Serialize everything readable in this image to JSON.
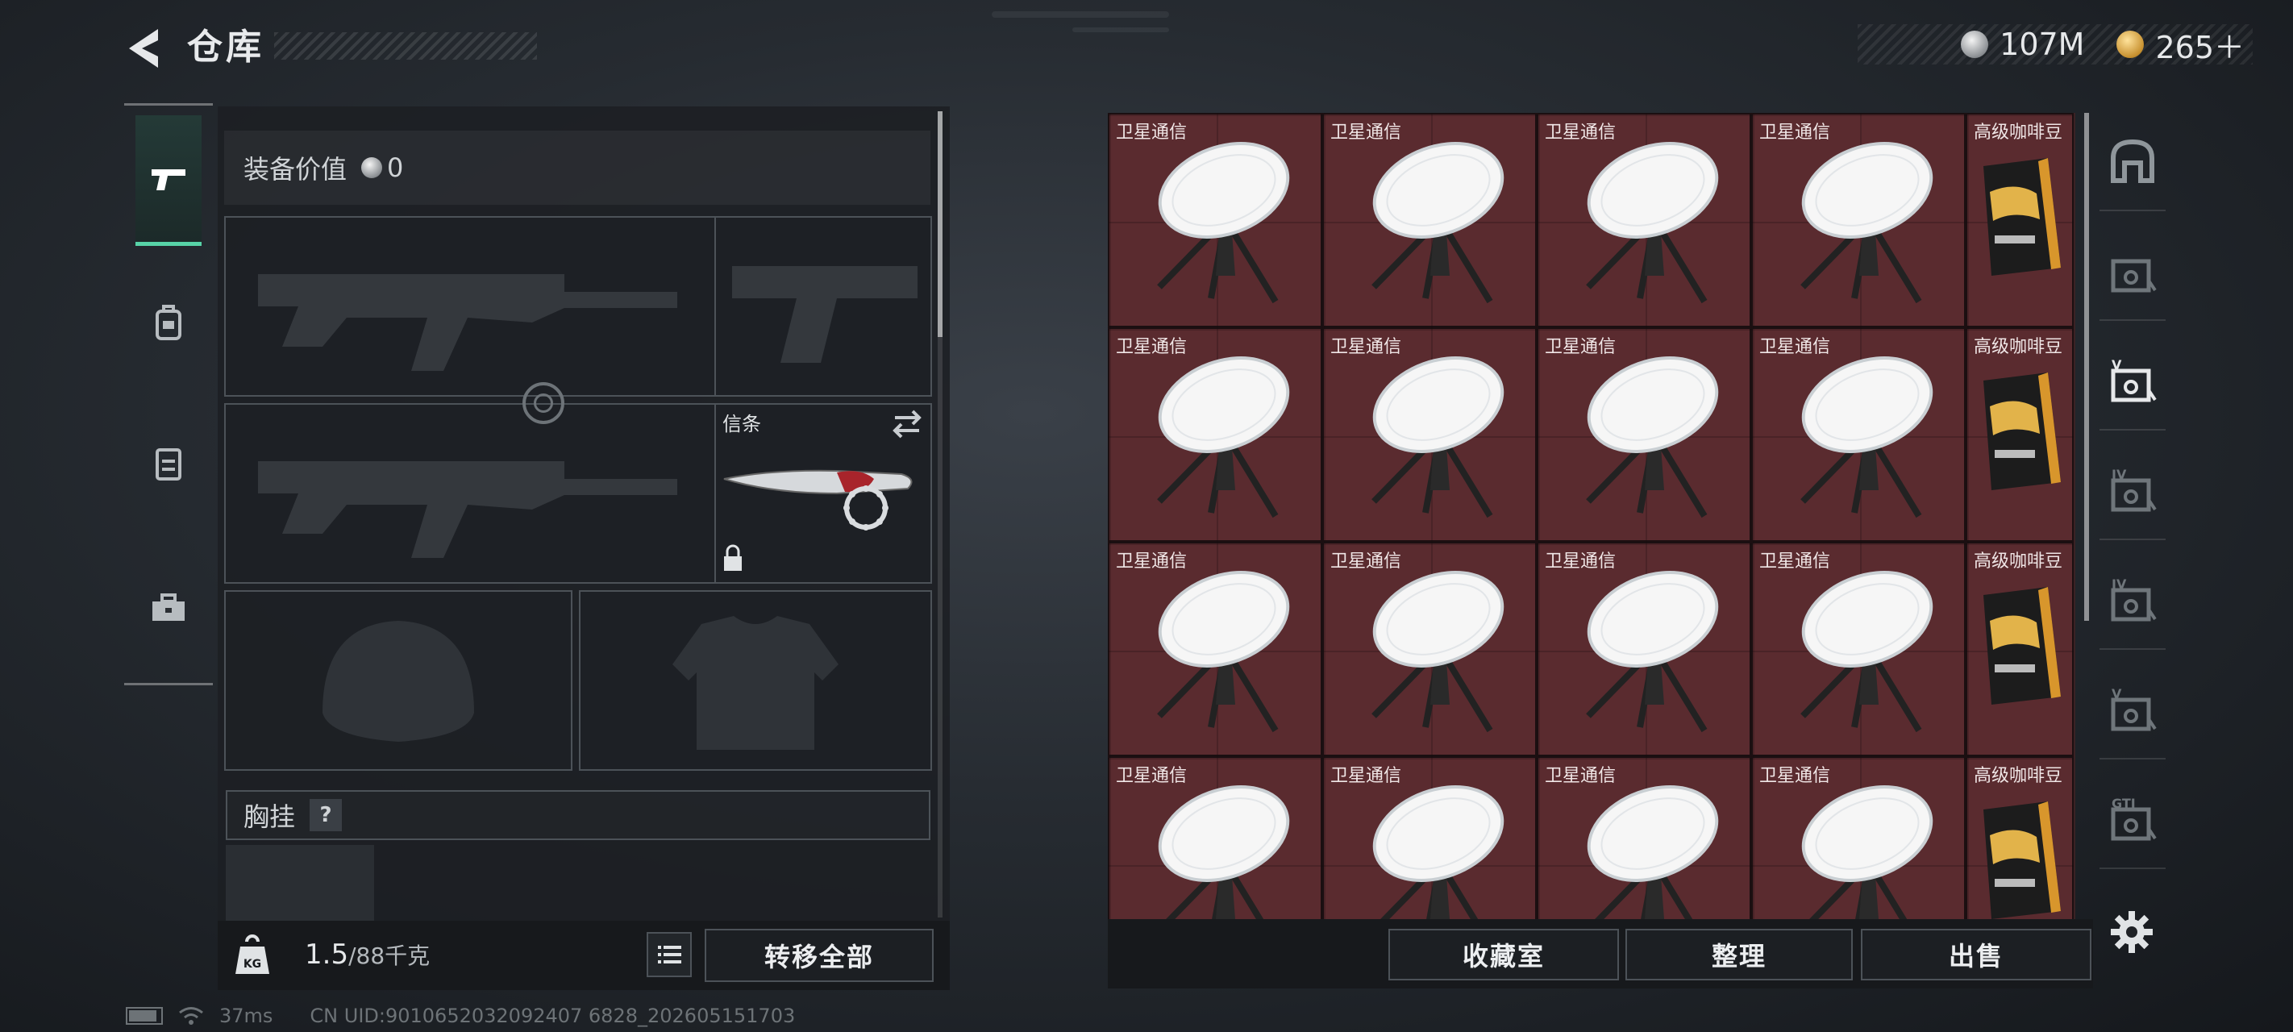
{
  "header": {
    "title": "仓库"
  },
  "currency": {
    "silver": "107M",
    "gold": "265＋"
  },
  "left_tabs": [
    "pistol-icon",
    "backpack-icon",
    "vest-icon",
    "toolbox-icon"
  ],
  "loadout": {
    "gear_value_label": "装备价值",
    "gear_value": "0",
    "melee_slot_label": "信条",
    "chest_rig_label": "胸挂",
    "chest_rig_help": "?"
  },
  "weight": {
    "current": "1.5",
    "max_unit": "/88千克",
    "icon_label": "KG"
  },
  "buttons": {
    "transfer_all": "转移全部",
    "collection": "收藏室",
    "sort": "整理",
    "sell": "出售"
  },
  "status": {
    "ping": "37ms",
    "uid": "CN UID:9010652032092407 6828_202605151703"
  },
  "stash": {
    "rows": [
      [
        "卫星通信",
        "卫星通信",
        "卫星通信",
        "卫星通信",
        "高级咖啡豆"
      ],
      [
        "卫星通信",
        "卫星通信",
        "卫星通信",
        "卫星通信",
        "高级咖啡豆"
      ],
      [
        "卫星通信",
        "卫星通信",
        "卫星通信",
        "卫星通信",
        "高级咖啡豆"
      ],
      [
        "卫星通信",
        "卫星通信",
        "卫星通信",
        "卫星通信",
        "高级咖啡豆"
      ]
    ]
  },
  "right_tabs": [
    {
      "icon": "armor-box-icon",
      "label": ""
    },
    {
      "icon": "crate-icon",
      "label": ""
    },
    {
      "icon": "vault-v-icon",
      "label": "V"
    },
    {
      "icon": "vault-iv-icon",
      "label": "IV"
    },
    {
      "icon": "vault-iv-b-icon",
      "label": "IV"
    },
    {
      "icon": "vault-v-b-icon",
      "label": "V"
    },
    {
      "icon": "vault-gti-icon",
      "label": "GTI"
    }
  ],
  "colors": {
    "accent": "#57d3a7",
    "stash_cell": "#5a2b2f"
  }
}
